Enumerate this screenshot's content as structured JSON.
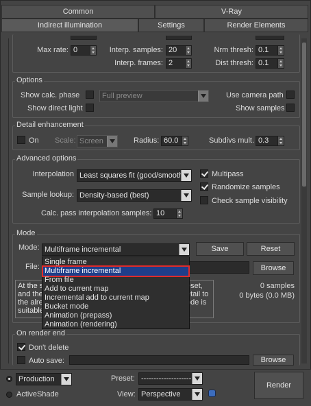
{
  "tabs": {
    "common": "Common",
    "vray": "V-Ray",
    "indirect": "Indirect illumination",
    "settings": "Settings",
    "render_elements": "Render Elements"
  },
  "top_rows": {
    "max_rate_label": "Max rate:",
    "max_rate_value": "0",
    "interp_samples_label": "Interp. samples:",
    "interp_samples_value": "20",
    "nrm_thresh_label": "Nrm thresh:",
    "nrm_thresh_value": "0.1",
    "interp_frames_label": "Interp. frames:",
    "interp_frames_value": "2",
    "dist_thresh_label": "Dist thresh:",
    "dist_thresh_value": "0.1"
  },
  "options": {
    "title": "Options",
    "show_calc_phase": "Show calc. phase",
    "preview_select": "Full preview",
    "use_camera_path": "Use camera path",
    "show_direct_light": "Show direct light",
    "show_samples": "Show samples"
  },
  "detail": {
    "title": "Detail enhancement",
    "on_label": "On",
    "scale_label": "Scale:",
    "scale_value": "Screen",
    "radius_label": "Radius:",
    "radius_value": "60.0",
    "subdivs_label": "Subdivs mult.",
    "subdivs_value": "0.3"
  },
  "advanced": {
    "title": "Advanced options",
    "interpolation_label": "Interpolation",
    "interpolation_value": "Least squares fit (good/smooth",
    "multipass": "Multipass",
    "sample_lookup_label": "Sample lookup:",
    "sample_lookup_value": "Density-based (best)",
    "randomize_samples": "Randomize samples",
    "check_visibility": "Check sample visibility",
    "calc_pass_label": "Calc. pass interpolation samples:",
    "calc_pass_value": "10"
  },
  "mode": {
    "title": "Mode",
    "mode_label": "Mode:",
    "mode_value": "Multiframe incremental",
    "save": "Save",
    "reset": "Reset",
    "file_label": "File:",
    "browse": "Browse",
    "info_lines": [
      "At the s",
      "and the",
      "the alre",
      "suitable"
    ],
    "info_right_lines": [
      "eset,",
      "etail to",
      "ode is"
    ],
    "samples": "0 samples",
    "bytes": "0 bytes (0.0 MB)",
    "options": [
      "Single frame",
      "Multiframe incremental",
      "From file",
      "Add to current map",
      "Incremental add to current map",
      "Bucket mode",
      "Animation (prepass)",
      "Animation (rendering)"
    ]
  },
  "render_end": {
    "title": "On render end",
    "dont_delete": "Don't delete",
    "auto_save": "Auto save:",
    "browse": "Browse"
  },
  "bottom": {
    "production": "Production",
    "activeshade": "ActiveShade",
    "preset_label": "Preset:",
    "preset_value": "--------------------",
    "view_label": "View:",
    "view_value": "Perspective",
    "render": "Render"
  }
}
